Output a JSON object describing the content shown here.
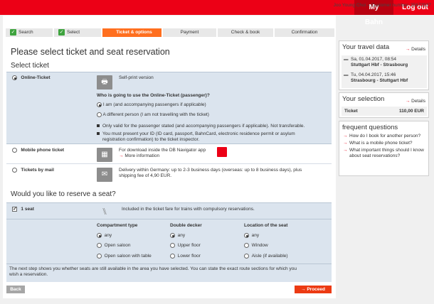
{
  "topbar": {
    "mybahn": "My Bahn",
    "logout": "Log out"
  },
  "customer": "Joo Young Choi – Customer number: 35672937",
  "steps": [
    {
      "label": "Search",
      "done": true
    },
    {
      "label": "Select",
      "done": true
    },
    {
      "label": "Ticket & options",
      "active": true
    },
    {
      "label": "Payment"
    },
    {
      "label": "Check & book"
    },
    {
      "label": "Confirmation"
    }
  ],
  "title": "Please select ticket and seat reservation",
  "select_ticket": {
    "heading": "Select ticket",
    "online": {
      "label": "Online-Ticket",
      "desc": "Self-print version",
      "question": "Who is going to use the Online-Ticket (passenger)?",
      "opt1": "I am (and accompanying passengers if applicable)",
      "opt2": "A different person (I am not travelling with the ticket)",
      "note1": "Only valid for the passenger stated (and accompanying passengers if applicable). Not transferable.",
      "note2a": "You must present your ID (ID card, passport, BahnCard, electronic residence permit or asylum",
      "note2b": "registration confirmation) to the ticket inspector."
    },
    "mobile": {
      "label": "Mobile phone ticket",
      "desc": "For download inside the DB Navigator app",
      "more": "More information"
    },
    "mail": {
      "label": "Tickets by mail",
      "desc1": "Delivery within Germany: up to 2-3 business days (overseas: up to 8 business days), plus",
      "desc2": "shipping fee of 4,90 EUR."
    }
  },
  "reserve": {
    "heading": "Would you like to reserve a seat?",
    "seat_label": "1 seat",
    "seat_desc": "Included in the ticket fare for trains with compulsory reservations.",
    "col1": {
      "title": "Compartment type",
      "opts": [
        "any",
        "Open saloon",
        "Open saloon with table"
      ]
    },
    "col2": {
      "title": "Double decker",
      "opts": [
        "any",
        "Upper floor",
        "Lower floor"
      ]
    },
    "col3": {
      "title": "Location of the seat",
      "opts": [
        "any",
        "Window",
        "Aisle (if available)"
      ]
    },
    "note1": "The next step shows you whether seats are still available in the area you have selected. You can state the exact route sections for which you",
    "note2": "wish a reservation."
  },
  "buttons": {
    "back": "Back",
    "proceed": "Proceed"
  },
  "travel": {
    "heading": "Your travel data",
    "details": "Details",
    "out_date": "Sa, 01.04.2017, 08:54",
    "out_route": "Stuttgart Hbf - Strasbourg",
    "ret_date": "Tu, 04.04.2017, 15:46",
    "ret_route": "Strasbourg - Stuttgart Hbf"
  },
  "selection": {
    "heading": "Your selection",
    "details": "Details",
    "item": "Ticket",
    "price": "110,00 EUR"
  },
  "faq": {
    "heading": "frequent questions",
    "q1": "How do I book for another person?",
    "q2": "What is a mobile phone ticket?",
    "q3": "What important things should I know about seat reservations?"
  }
}
